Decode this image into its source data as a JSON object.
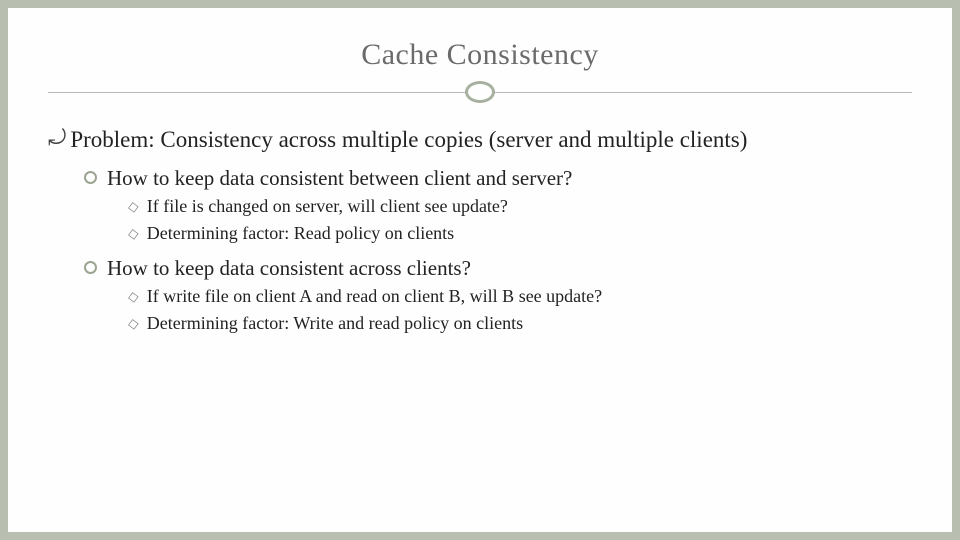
{
  "title": "Cache Consistency",
  "l1_text": "Problem: Consistency across multiple copies (server and multiple clients)",
  "sections": [
    {
      "heading": "How to keep data consistent between client and server?",
      "items": [
        "If file is changed on server, will client see update?",
        "Determining factor: Read policy on clients"
      ]
    },
    {
      "heading": "How to keep data consistent across clients?",
      "items": [
        "If write file on client A and read on client B, will B see update?",
        "Determining factor: Write and read policy on clients"
      ]
    }
  ]
}
